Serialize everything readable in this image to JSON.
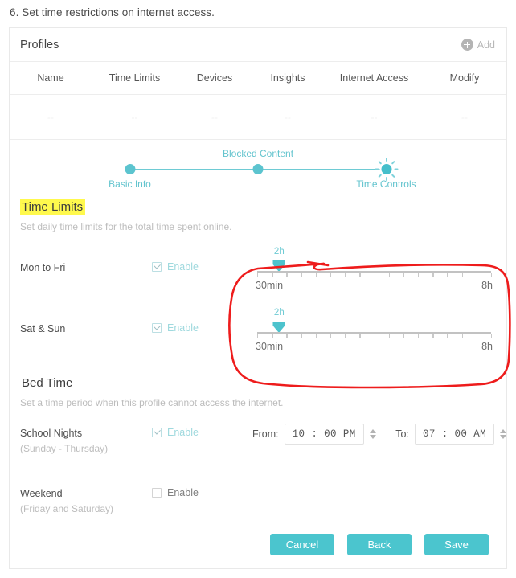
{
  "instruction": "6. Set time restrictions on internet access.",
  "profiles": {
    "title": "Profiles",
    "add_label": "Add",
    "add_icon": "circle-plus-icon",
    "columns": [
      "Name",
      "Time Limits",
      "Devices",
      "Insights",
      "Internet Access",
      "Modify"
    ],
    "rows": [
      [
        "--",
        "--",
        "--",
        "--",
        "--",
        "--"
      ]
    ]
  },
  "stepper": {
    "steps": [
      {
        "label": "Basic Info",
        "position": "below",
        "active": false
      },
      {
        "label": "Blocked Content",
        "position": "above",
        "active": false
      },
      {
        "label": "Time Controls",
        "position": "below",
        "active": true
      }
    ]
  },
  "time_limits": {
    "heading": "Time Limits",
    "heading_highlight": "#fff94d",
    "description": "Set daily time limits for the total time spent online.",
    "rows": [
      {
        "label": "Mon to Fri",
        "enable_label": "Enable",
        "checked": true,
        "slider": {
          "value": "2h",
          "min_label": "30min",
          "max_label": "8h",
          "ticks": 16,
          "handle_pct": 11
        }
      },
      {
        "label": "Sat & Sun",
        "enable_label": "Enable",
        "checked": true,
        "slider": {
          "value": "2h",
          "min_label": "30min",
          "max_label": "8h",
          "ticks": 16,
          "handle_pct": 11
        }
      }
    ]
  },
  "bed_time": {
    "heading": "Bed Time",
    "description": "Set a time period when this profile cannot access the internet.",
    "school_nights": {
      "label": "School Nights",
      "sub_label": "(Sunday - Thursday)",
      "enable_label": "Enable",
      "checked": true,
      "from_label": "From:",
      "from_value": "10 : 00  PM",
      "to_label": "To:",
      "to_value": "07 : 00  AM"
    },
    "weekend": {
      "label": "Weekend",
      "sub_label": "(Friday and Saturday)",
      "enable_label": "Enable",
      "checked": false
    }
  },
  "footer": {
    "cancel_label": "Cancel",
    "back_label": "Back",
    "save_label": "Save"
  },
  "annotation": {
    "type": "hand-drawn-ellipse",
    "color": "#ee1c1c",
    "target": "time-limit-sliders"
  },
  "theme": {
    "accent": "#4bc5ce",
    "accent_light": "#6fcbd4",
    "annotation_red": "#ee1c1c",
    "highlight_yellow": "#fff94d"
  }
}
